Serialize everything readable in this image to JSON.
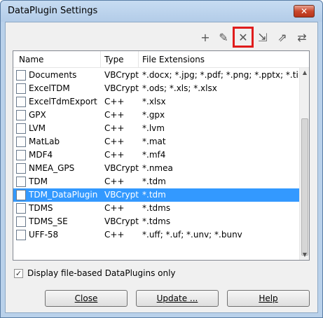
{
  "window": {
    "title": "DataPlugin Settings",
    "close_glyph": "✕"
  },
  "toolbar": {
    "icons": [
      {
        "name": "add-icon",
        "glyph": "+"
      },
      {
        "name": "edit-icon",
        "glyph": "✎"
      },
      {
        "name": "delete-icon",
        "glyph": "✕"
      },
      {
        "name": "import-icon",
        "glyph": "⇲"
      },
      {
        "name": "export-icon",
        "glyph": "⇗"
      },
      {
        "name": "transfer-icon",
        "glyph": "⇄"
      }
    ]
  },
  "table": {
    "headers": [
      "Name",
      "Type",
      "File Extensions"
    ],
    "rows": [
      {
        "name": "Documents",
        "type": "VBCrypt",
        "ext": "*.docx; *.jpg; *.pdf; *.png; *.pptx; *.tif; *.xlsx",
        "icon": "doc-icon"
      },
      {
        "name": "ExcelTDM",
        "type": "VBCrypt",
        "ext": "*.ods; *.xls; *.xlsx",
        "icon": "excel-icon"
      },
      {
        "name": "ExcelTdmExport",
        "type": "C++",
        "ext": "*.xlsx",
        "icon": "file-icon"
      },
      {
        "name": "GPX",
        "type": "C++",
        "ext": "*.gpx",
        "icon": "gpx-icon"
      },
      {
        "name": "LVM",
        "type": "C++",
        "ext": "*.lvm",
        "icon": "lvm-icon"
      },
      {
        "name": "MatLab",
        "type": "C++",
        "ext": "*.mat",
        "icon": "file-icon"
      },
      {
        "name": "MDF4",
        "type": "C++",
        "ext": "*.mf4",
        "icon": "file-icon"
      },
      {
        "name": "NMEA_GPS",
        "type": "VBCrypt",
        "ext": "*.nmea",
        "icon": "nmea-icon"
      },
      {
        "name": "TDM",
        "type": "C++",
        "ext": "*.tdm",
        "icon": "tdm-icon"
      },
      {
        "name": "TDM_DataPlugin",
        "type": "VBCrypt",
        "ext": "*.tdm",
        "icon": "file-icon",
        "selected": true
      },
      {
        "name": "TDMS",
        "type": "C++",
        "ext": "*.tdms",
        "icon": "tdms-icon"
      },
      {
        "name": "TDMS_SE",
        "type": "VBCrypt",
        "ext": "*.tdms",
        "icon": "tdms-se-icon"
      },
      {
        "name": "UFF-58",
        "type": "C++",
        "ext": "*.uff; *.uf; *.unv; *.bunv",
        "icon": "file-icon"
      }
    ]
  },
  "filter": {
    "label": "Display file-based DataPlugins only",
    "checked": true,
    "check_glyph": "✓"
  },
  "buttons": {
    "close": "Close",
    "update": "Update ...",
    "help": "Help"
  }
}
